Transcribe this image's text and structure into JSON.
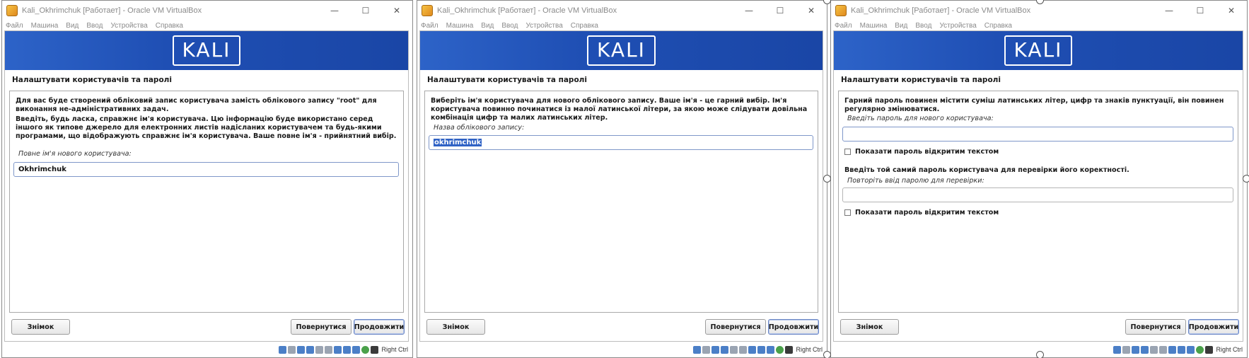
{
  "windows": [
    {
      "title": "Kali_Okhrimchuk [Работает] - Oracle VM VirtualBox",
      "menu": [
        "Файл",
        "Машина",
        "Вид",
        "Ввод",
        "Устройства",
        "Справка"
      ],
      "logo_text": "KALI",
      "step_title": "Налаштувати користувачів та паролі",
      "desc1": "Для вас буде створений обліковий запис користувача замість облікового запису \"root\" для виконання не-адміністративних задач.",
      "desc2": "Введіть, будь ласка, справжнє ім'я користувача. Цю інформацію буде використано серед іншого як типове джерело для електронних листів надісланих користувачем та будь-якими програмами, що відображують справжнє ім'я користувача. Ваше повне ім'я - прийнятний вибір.",
      "field_label": "Повне ім'я нового користувача:",
      "field_value": "Okhrimchuk",
      "buttons": {
        "screenshot": "Знімок",
        "back": "Повернутися",
        "continue": "Продовжити"
      },
      "host_key": "Right Ctrl"
    },
    {
      "title": "Kali_Okhrimchuk [Работает] - Oracle VM VirtualBox",
      "menu": [
        "Файл",
        "Машина",
        "Вид",
        "Ввод",
        "Устройства",
        "Справка"
      ],
      "logo_text": "KALI",
      "step_title": "Налаштувати користувачів та паролі",
      "desc1": "Виберіть ім'я користувача для нового облікового запису. Ваше ім'я - це гарний вибір. Ім'я користувача повинно починатися із малої латинської літери, за якою може слідувати довільна комбінація цифр та малих латинських літер.",
      "field_label": "Назва облікового запису:",
      "field_value": "okhrimchuk",
      "buttons": {
        "screenshot": "Знімок",
        "back": "Повернутися",
        "continue": "Продовжити"
      },
      "host_key": "Right Ctrl"
    },
    {
      "title": "Kali_Okhrimchuk [Работает] - Oracle VM VirtualBox",
      "menu": [
        "Файл",
        "Машина",
        "Вид",
        "Ввод",
        "Устройства",
        "Справка"
      ],
      "logo_text": "KALI",
      "step_title": "Налаштувати користувачів та паролі",
      "desc1": "Гарний пароль повинен містити суміш латинських літер, цифр та знаків пунктуації, він повинен регулярно змінюватися.",
      "field_label": "Введіть пароль для нового користувача:",
      "field_value": "",
      "show_password_1": "Показати пароль відкритим текстом",
      "desc2": "Введіть той самий пароль користувача для перевірки його коректності.",
      "field2_label": "Повторіть ввід паролю для перевірки:",
      "field2_value": "",
      "show_password_2": "Показати пароль відкритим текстом",
      "buttons": {
        "screenshot": "Знімок",
        "back": "Повернутися",
        "continue": "Продовжити"
      },
      "host_key": "Right Ctrl"
    }
  ]
}
